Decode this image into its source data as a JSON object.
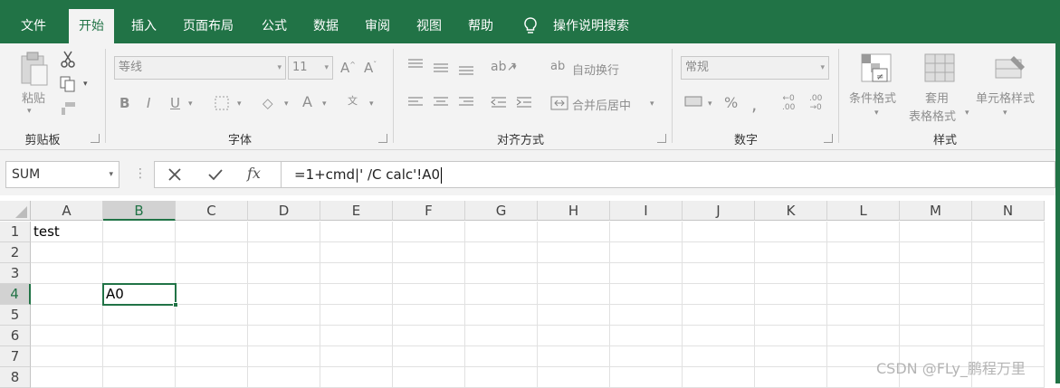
{
  "menubar": {
    "tabs": [
      {
        "label": "文件",
        "active": false
      },
      {
        "label": "开始",
        "active": true
      },
      {
        "label": "插入",
        "active": false
      },
      {
        "label": "页面布局",
        "active": false
      },
      {
        "label": "公式",
        "active": false
      },
      {
        "label": "数据",
        "active": false
      },
      {
        "label": "审阅",
        "active": false
      },
      {
        "label": "视图",
        "active": false
      },
      {
        "label": "帮助",
        "active": false
      }
    ],
    "tell_me": "操作说明搜索",
    "tell_me_icon": "lightbulb-icon"
  },
  "ribbon": {
    "clipboard": {
      "label": "剪贴板",
      "paste": "粘贴"
    },
    "font": {
      "label": "字体",
      "font_name": "等线",
      "font_size": "11"
    },
    "alignment": {
      "label": "对齐方式",
      "wrap_text": "自动换行",
      "merge_center": "合并后居中"
    },
    "number": {
      "label": "数字",
      "format": "常规"
    },
    "styles": {
      "label": "样式",
      "conditional_format": "条件格式",
      "format_as_table_1": "套用",
      "format_as_table_2": "表格格式",
      "cell_styles": "单元格样式"
    }
  },
  "formula_bar": {
    "name_box": "SUM",
    "fx_label": "fx",
    "content": "=1+cmd|' /C calc'!A0"
  },
  "sheet": {
    "columns": [
      "A",
      "B",
      "C",
      "D",
      "E",
      "F",
      "G",
      "H",
      "I",
      "J",
      "K",
      "L",
      "M",
      "N"
    ],
    "selected_column": "B",
    "rows": [
      "1",
      "2",
      "3",
      "4",
      "5",
      "6",
      "7",
      "8"
    ],
    "selected_row": "4",
    "cells": {
      "A1": "test",
      "B4": "A0"
    }
  },
  "watermark": "CSDN @FLy_鹏程万里",
  "colors": {
    "accent": "#217346"
  }
}
